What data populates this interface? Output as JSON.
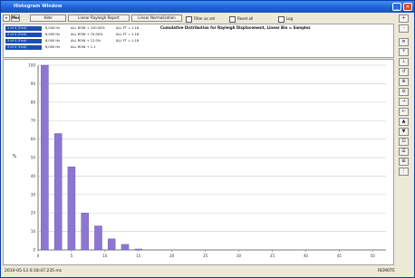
{
  "window": {
    "title": "Histogram Window",
    "min_label": "_",
    "close_label": "×"
  },
  "toolbar": {
    "menu_label": "Menu",
    "buttons": [
      "Hide",
      "Linear Rayleigh Report",
      "Linear Normalization"
    ],
    "checkboxes": [
      "Filter as set",
      "Reset all",
      "Log"
    ]
  },
  "legend": {
    "items": [
      {
        "swatch": "1 of 4 (Fwd)",
        "c1": "6,000 Hz",
        "c2": "ALL ROW + 100.00%",
        "c3": "ALL FT = 1.18"
      },
      {
        "swatch": "2 of 4 (Fwd)",
        "c1": "6,000 Hz",
        "c2": "ALL ROW + 74.00%",
        "c3": "ALL FT = 1.18"
      },
      {
        "swatch": "3 of 4 (Fwd)",
        "c1": "6,000 Hz",
        "c2": "ALL ROW + 12.0%",
        "c3": "ALL FT = 1.18"
      },
      {
        "swatch": "4 of 4 (Fwd)",
        "c1": "6,000 Hz",
        "c2": "ALL ROW + 1.1",
        "c3": ""
      }
    ],
    "caption": "Cumulative Distribution for Rayleigh Displacement, Linear Bin = Samples"
  },
  "sidebar": {
    "buttons": [
      "+",
      "-",
      "≡",
      "⇡",
      "⇣",
      "↺",
      "⊕",
      "⊖",
      "→",
      "←",
      "▲",
      "▼",
      "⊡",
      "☰",
      "⊞",
      "⋮"
    ]
  },
  "status": {
    "left": "2010-05-13  0:18:47.235 ms",
    "right": "REMOTE"
  },
  "chart_data": {
    "type": "bar",
    "title": "",
    "xlabel": "",
    "ylabel": "%",
    "x_ticks": [
      "0",
      "5",
      "10",
      "15",
      "20",
      "25",
      "30",
      "35",
      "40",
      "45",
      "50"
    ],
    "y_ticks": [
      "0",
      "10",
      "20",
      "30",
      "40",
      "50",
      "60",
      "70",
      "80",
      "90",
      "100"
    ],
    "xlim": [
      0,
      52
    ],
    "ylim": [
      0,
      100
    ],
    "grid": true,
    "x": [
      1,
      3,
      5,
      7,
      9,
      11,
      13,
      15
    ],
    "values": [
      100,
      63,
      45,
      20,
      13,
      6,
      3,
      0.5
    ],
    "bar_color": "#8c76d0"
  }
}
